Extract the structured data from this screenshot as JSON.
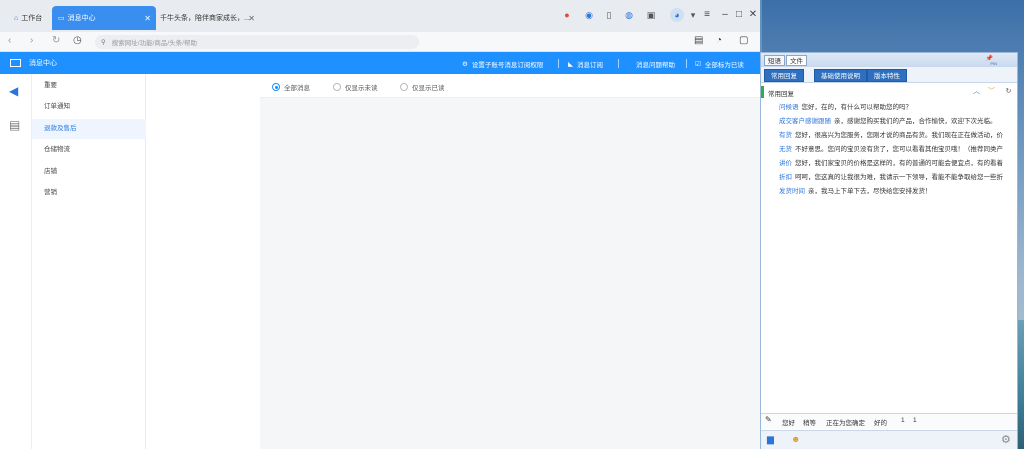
{
  "tabs": [
    {
      "label": "工作台",
      "icon": "home-icon"
    },
    {
      "label": "消息中心",
      "icon": "chat-icon"
    },
    {
      "label": "千牛头条，陪伴商家成长，...",
      "icon": ""
    }
  ],
  "address": {
    "placeholder": "搜索网址/功能/商品/头条/帮助"
  },
  "appbar": {
    "title": "消息中心",
    "actions": [
      "设置子账号消息订阅权限",
      "消息订阅",
      "消息问题帮助",
      "全部标为已读"
    ]
  },
  "menu": {
    "items": [
      "重要",
      "订单通知",
      "退款及售后",
      "仓储物流",
      "店铺",
      "营销"
    ],
    "active_index": 2
  },
  "filter": {
    "options": [
      "全部消息",
      "仅显示未读",
      "仅显示已读"
    ],
    "selected_index": 0
  },
  "quick_reply": {
    "tabs": [
      "短语",
      "文件"
    ],
    "subtabs": [
      "常用回复",
      "基础使用说明",
      "版本特性"
    ],
    "group": "常用回复",
    "pin_label": "PIN",
    "rows": [
      {
        "key": "问候语",
        "text": "您好，在的，有什么可以帮助您的吗？"
      },
      {
        "key": "成交客户感谢跟随",
        "text": "亲，感谢您购买我们的产品，合作愉快，欢迎下次光临。"
      },
      {
        "key": "有货",
        "text": "您好，很高兴为您服务，您刚才说的商品有货。我们现在正在做活动，价"
      },
      {
        "key": "无货",
        "text": "不好意思。您问的宝贝没有货了，您可以看看其他宝贝哦！（推荐同类产"
      },
      {
        "key": "讲价",
        "text": "您好，我们家宝贝的价格是这样的，有的普通的可能会便宜点，有的看着"
      },
      {
        "key": "折扣",
        "text": "呵呵，您这真的让我很为难，我请示一下领导，看能不能争取给您一些折"
      },
      {
        "key": "发货时间",
        "text": "亲，我马上下单下去，尽快给您安排发货！"
      }
    ],
    "bottom_words": [
      "您好",
      "稍等",
      "正在为您确定",
      "好的",
      "1",
      "1"
    ]
  }
}
